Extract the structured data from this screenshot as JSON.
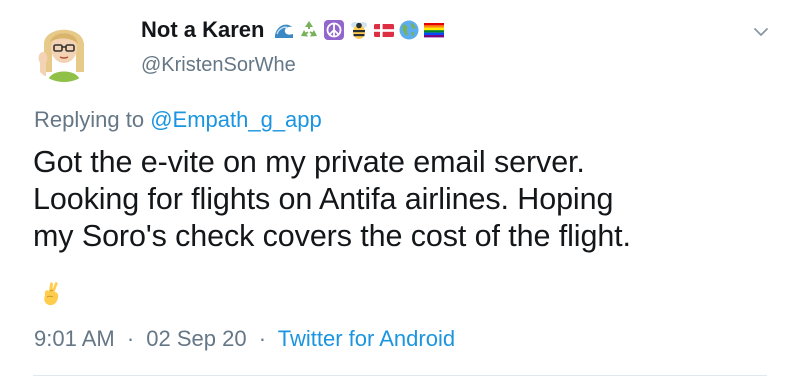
{
  "author": {
    "display_name": "Not a Karen",
    "handle": "@KristenSorWhe",
    "name_emojis": [
      "wave-icon",
      "recycle-icon",
      "peace-icon",
      "bee-icon",
      "denmark-flag-icon",
      "globe-icon",
      "rainbow-flag-icon"
    ]
  },
  "reply": {
    "prefix": "Replying to",
    "mention": "@Empath_g_app"
  },
  "tweet": {
    "text": "Got the e-vite on my private email server.\nLooking for flights on Antifa airlines. Hoping\nmy Soro's check covers the cost of the flight.",
    "trailing_emoji": "crossed-fingers-icon"
  },
  "meta": {
    "time": "9:01 AM",
    "separator": "·",
    "date": "02 Sep 20",
    "source": "Twitter for Android"
  },
  "colors": {
    "text": "#14171a",
    "secondary": "#657786",
    "link": "#1b95e0",
    "divider": "#e1e8ed"
  }
}
